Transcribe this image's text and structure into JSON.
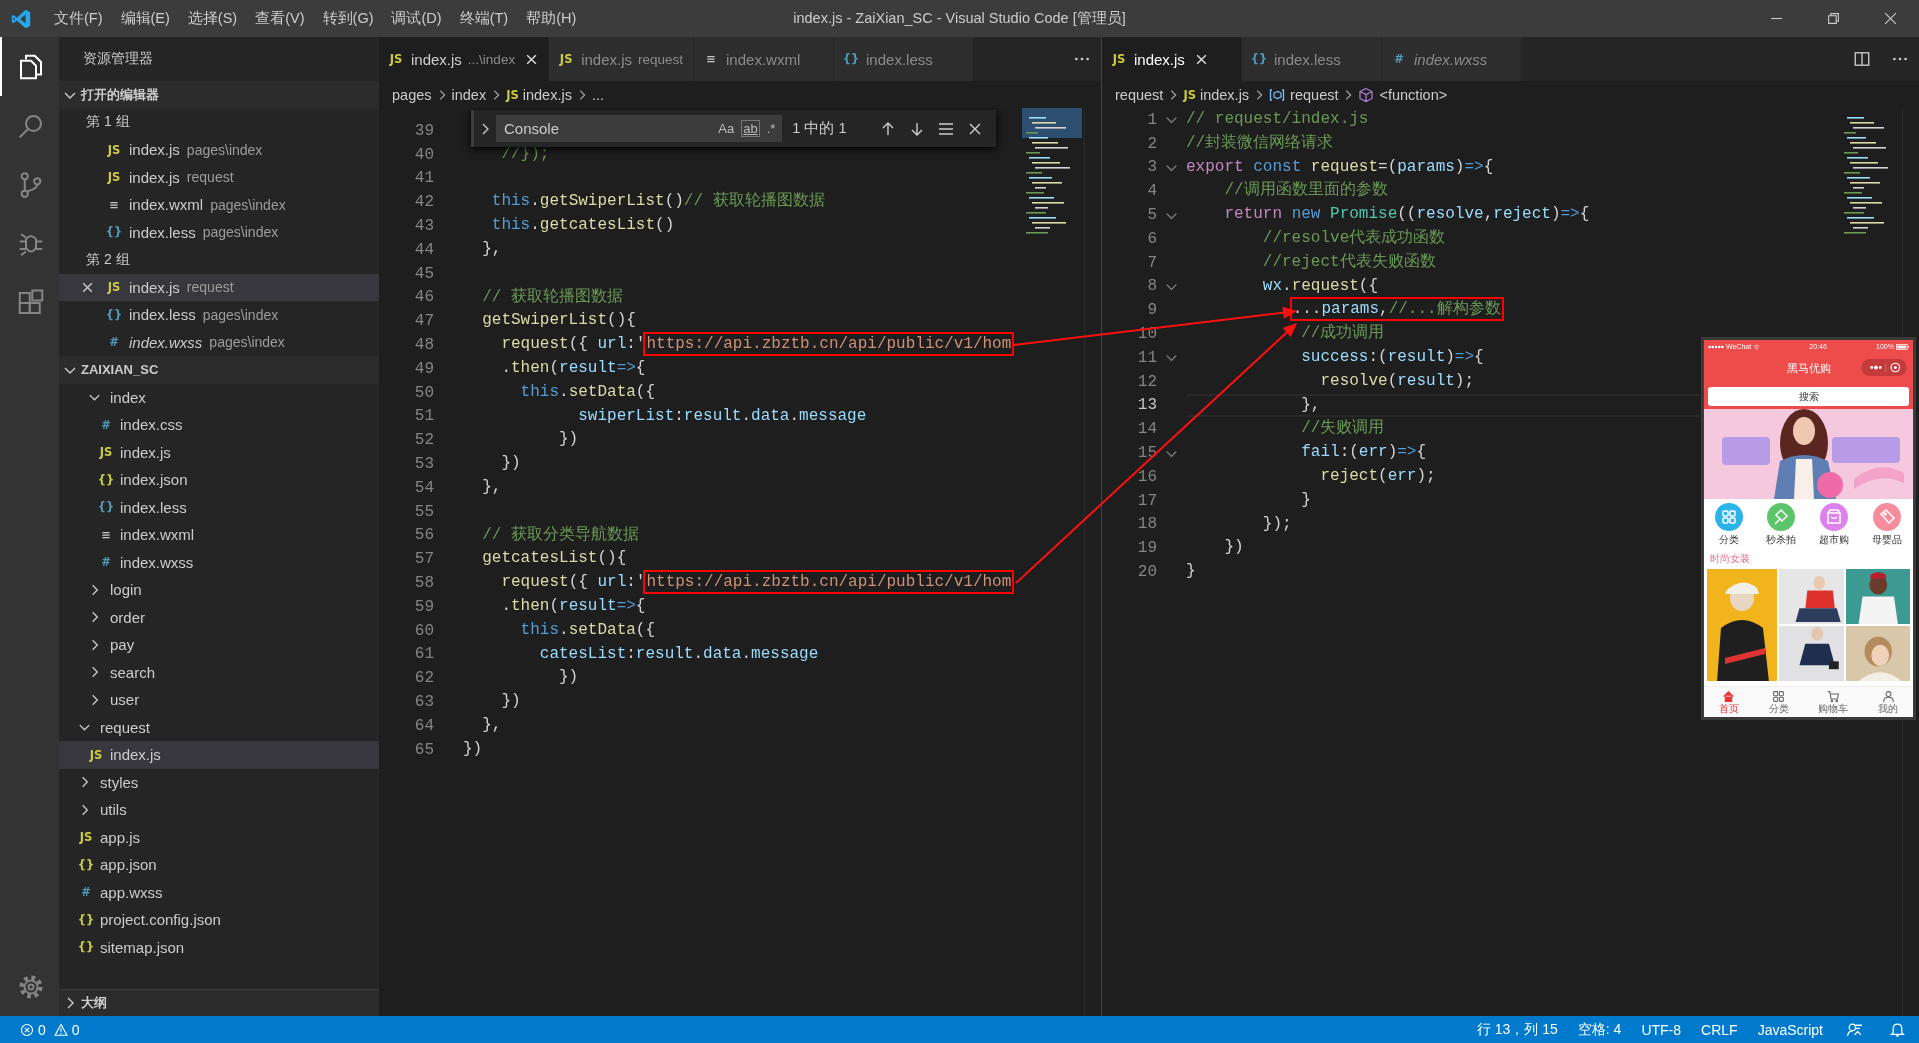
{
  "title_bar": {
    "menus": [
      "文件(F)",
      "编辑(E)",
      "选择(S)",
      "查看(V)",
      "转到(G)",
      "调试(D)",
      "终端(T)",
      "帮助(H)"
    ],
    "title": "index.js - ZaiXian_SC - Visual Studio Code [管理员]"
  },
  "activity_bar": {
    "items": [
      {
        "kind": "explorer",
        "selected": true
      },
      {
        "kind": "search",
        "selected": false
      },
      {
        "kind": "source-control",
        "selected": false
      },
      {
        "kind": "debug",
        "selected": false
      },
      {
        "kind": "extensions",
        "selected": false
      }
    ]
  },
  "sidebar": {
    "title": "资源管理器",
    "open_editors": {
      "title": "打开的编辑器",
      "expanded": true,
      "groups": [
        {
          "title": "第 1 组",
          "items": [
            {
              "icon": "JS",
              "kind": "js",
              "name": "index.js",
              "path": "pages\\index",
              "selected": false,
              "preview": false
            },
            {
              "icon": "JS",
              "kind": "js",
              "name": "index.js",
              "path": "request",
              "selected": false,
              "preview": false
            },
            {
              "icon": "≡",
              "kind": "wxml",
              "name": "index.wxml",
              "path": "pages\\index",
              "selected": false,
              "preview": false
            },
            {
              "icon": "{}",
              "kind": "less",
              "name": "index.less",
              "path": "pages\\index",
              "selected": false,
              "preview": false
            }
          ]
        },
        {
          "title": "第 2 组",
          "items": [
            {
              "icon": "JS",
              "kind": "js",
              "name": "index.js",
              "path": "request",
              "selected": true,
              "preview": false
            },
            {
              "icon": "{}",
              "kind": "less",
              "name": "index.less",
              "path": "pages\\index",
              "selected": false,
              "preview": false
            },
            {
              "icon": "#",
              "kind": "wxss",
              "name": "index.wxss",
              "path": "pages\\index",
              "selected": false,
              "preview": true
            }
          ]
        }
      ]
    },
    "folder": {
      "title": "ZAIXIAN_SC",
      "expanded": true,
      "items": [
        {
          "kind": "continued",
          "children": [
            {
              "kind": "folder",
              "name": "index",
              "expanded": true,
              "selected": false,
              "children": [
                {
                  "icon": "#",
                  "kind": "css",
                  "name": "index.css",
                  "selected": false
                },
                {
                  "icon": "JS",
                  "kind": "js",
                  "name": "index.js",
                  "selected": false
                },
                {
                  "icon": "{}",
                  "kind": "json",
                  "name": "index.json",
                  "selected": false
                },
                {
                  "icon": "{}",
                  "kind": "less",
                  "name": "index.less",
                  "selected": false
                },
                {
                  "icon": "≡",
                  "kind": "wxml",
                  "name": "index.wxml",
                  "selected": false
                },
                {
                  "icon": "#",
                  "kind": "wxss",
                  "name": "index.wxss",
                  "selected": false
                }
              ]
            },
            {
              "kind": "folder",
              "name": "login",
              "expanded": false,
              "selected": false
            },
            {
              "kind": "folder",
              "name": "order",
              "expanded": false,
              "selected": false
            },
            {
              "kind": "folder",
              "name": "pay",
              "expanded": false,
              "selected": false
            },
            {
              "kind": "folder",
              "name": "search",
              "expanded": false,
              "selected": false
            },
            {
              "kind": "folder",
              "name": "user",
              "expanded": false,
              "selected": false
            }
          ]
        },
        {
          "kind": "folder",
          "name": "request",
          "expanded": true,
          "selected": false,
          "children": [
            {
              "icon": "JS",
              "kind": "js",
              "name": "index.js",
              "selected": true
            }
          ]
        },
        {
          "kind": "folder",
          "name": "styles",
          "expanded": false,
          "selected": false
        },
        {
          "kind": "folder",
          "name": "utils",
          "expanded": false,
          "selected": false
        },
        {
          "icon": "JS",
          "kind": "js",
          "name": "app.js",
          "selected": false
        },
        {
          "icon": "{}",
          "kind": "json",
          "name": "app.json",
          "selected": false
        },
        {
          "icon": "#",
          "kind": "wxss",
          "name": "app.wxss",
          "selected": false
        },
        {
          "icon": "{}",
          "kind": "json",
          "name": "project.config.json",
          "selected": false
        },
        {
          "icon": "{}",
          "kind": "json",
          "name": "sitemap.json",
          "selected": false
        }
      ]
    },
    "outline": {
      "title": "大纲",
      "expanded": false
    }
  },
  "editor_groups": [
    {
      "focused": false,
      "tabs": [
        {
          "icon": "JS",
          "kind": "js",
          "name": "index.js",
          "description": "...\\index",
          "selected": true,
          "preview": false
        },
        {
          "icon": "JS",
          "kind": "js",
          "name": "index.js",
          "description": "request",
          "selected": false,
          "preview": false
        },
        {
          "icon": "≡",
          "kind": "wxml",
          "name": "index.wxml",
          "selected": false,
          "preview": false
        },
        {
          "icon": "{}",
          "kind": "less",
          "name": "index.less",
          "selected": false,
          "preview": false
        }
      ],
      "breadcrumbs": [
        {
          "text": "pages"
        },
        {
          "text": "index"
        },
        {
          "text": "index.js",
          "icon": "JS",
          "kind": "js"
        },
        {
          "text": "..."
        }
      ],
      "find_widget": {
        "value": "Console",
        "options": [
          "Aa",
          "ab",
          ".*"
        ],
        "match_count": "1 中的 1"
      },
      "lines": [
        {
          "number": "39"
        },
        {
          "number": "40",
          "tokens": [
            {
              "kind": "comment",
              "text": "    //});"
            }
          ]
        },
        {
          "number": "41"
        },
        {
          "number": "42",
          "tokens": [
            {
              "kind": "keyword",
              "text": "   this"
            },
            {
              "kind": "plain",
              "text": "."
            },
            {
              "kind": "function",
              "text": "getSwiperList"
            },
            {
              "kind": "plain",
              "text": "()"
            },
            {
              "kind": "comment",
              "text": "// 获取轮播图数据"
            }
          ]
        },
        {
          "number": "43",
          "tokens": [
            {
              "kind": "keyword",
              "text": "   this"
            },
            {
              "kind": "plain",
              "text": "."
            },
            {
              "kind": "function",
              "text": "getcatesList"
            },
            {
              "kind": "plain",
              "text": "()"
            }
          ]
        },
        {
          "number": "44",
          "tokens": [
            {
              "kind": "plain",
              "text": "  },"
            }
          ]
        },
        {
          "number": "45"
        },
        {
          "number": "46",
          "tokens": [
            {
              "kind": "comment",
              "text": "  // 获取轮播图数据"
            }
          ]
        },
        {
          "number": "47",
          "tokens": [
            {
              "kind": "function",
              "text": "  getSwiperList"
            },
            {
              "kind": "plain",
              "text": "(){"
            }
          ]
        },
        {
          "number": "48",
          "tokens": [
            {
              "kind": "function",
              "text": "    request"
            },
            {
              "kind": "plain",
              "text": "({ "
            },
            {
              "kind": "variable",
              "text": "url"
            },
            {
              "kind": "plain",
              "text": ":'"
            }
          ],
          "boxed_tokens": [
            {
              "kind": "string",
              "text": "https://api.zbztb.cn/api/public/v1/hom"
            }
          ]
        },
        {
          "number": "49",
          "tokens": [
            {
              "kind": "plain",
              "text": "    ."
            },
            {
              "kind": "function",
              "text": "then"
            },
            {
              "kind": "plain",
              "text": "("
            },
            {
              "kind": "variable",
              "text": "result"
            },
            {
              "kind": "keyword",
              "text": "=>"
            },
            {
              "kind": "plain",
              "text": "{"
            }
          ]
        },
        {
          "number": "50",
          "tokens": [
            {
              "kind": "keyword",
              "text": "      this"
            },
            {
              "kind": "plain",
              "text": "."
            },
            {
              "kind": "function",
              "text": "setData"
            },
            {
              "kind": "plain",
              "text": "({"
            }
          ]
        },
        {
          "number": "51",
          "tokens": [
            {
              "kind": "variable",
              "text": "            swiperList"
            },
            {
              "kind": "plain",
              "text": ":"
            },
            {
              "kind": "variable",
              "text": "result"
            },
            {
              "kind": "plain",
              "text": "."
            },
            {
              "kind": "variable",
              "text": "data"
            },
            {
              "kind": "plain",
              "text": "."
            },
            {
              "kind": "variable",
              "text": "message"
            }
          ]
        },
        {
          "number": "52",
          "tokens": [
            {
              "kind": "plain",
              "text": "          })"
            }
          ]
        },
        {
          "number": "53",
          "tokens": [
            {
              "kind": "plain",
              "text": "    })"
            }
          ]
        },
        {
          "number": "54",
          "tokens": [
            {
              "kind": "plain",
              "text": "  },"
            }
          ]
        },
        {
          "number": "55"
        },
        {
          "number": "56",
          "tokens": [
            {
              "kind": "comment",
              "text": "  // 获取分类导航数据"
            }
          ]
        },
        {
          "number": "57",
          "tokens": [
            {
              "kind": "function",
              "text": "  getcatesList"
            },
            {
              "kind": "plain",
              "text": "(){"
            }
          ]
        },
        {
          "number": "58",
          "tokens": [
            {
              "kind": "function",
              "text": "    request"
            },
            {
              "kind": "plain",
              "text": "({ "
            },
            {
              "kind": "variable",
              "text": "url"
            },
            {
              "kind": "plain",
              "text": ":'"
            }
          ],
          "boxed_tokens": [
            {
              "kind": "string",
              "text": "https://api.zbztb.cn/api/public/v1/hom"
            }
          ]
        },
        {
          "number": "59",
          "tokens": [
            {
              "kind": "plain",
              "text": "    ."
            },
            {
              "kind": "function",
              "text": "then"
            },
            {
              "kind": "plain",
              "text": "("
            },
            {
              "kind": "variable",
              "text": "result"
            },
            {
              "kind": "keyword",
              "text": "=>"
            },
            {
              "kind": "plain",
              "text": "{"
            }
          ]
        },
        {
          "number": "60",
          "tokens": [
            {
              "kind": "keyword",
              "text": "      this"
            },
            {
              "kind": "plain",
              "text": "."
            },
            {
              "kind": "function",
              "text": "setData"
            },
            {
              "kind": "plain",
              "text": "({"
            }
          ]
        },
        {
          "number": "61",
          "tokens": [
            {
              "kind": "variable",
              "text": "        catesList"
            },
            {
              "kind": "plain",
              "text": ":"
            },
            {
              "kind": "variable",
              "text": "result"
            },
            {
              "kind": "plain",
              "text": "."
            },
            {
              "kind": "variable",
              "text": "data"
            },
            {
              "kind": "plain",
              "text": "."
            },
            {
              "kind": "variable",
              "text": "message"
            }
          ]
        },
        {
          "number": "62",
          "tokens": [
            {
              "kind": "plain",
              "text": "          })"
            }
          ]
        },
        {
          "number": "63",
          "tokens": [
            {
              "kind": "plain",
              "text": "    })"
            }
          ]
        },
        {
          "number": "64",
          "tokens": [
            {
              "kind": "plain",
              "text": "  },"
            }
          ]
        },
        {
          "number": "65",
          "tokens": [
            {
              "kind": "plain",
              "text": "})"
            }
          ]
        }
      ]
    },
    {
      "focused": true,
      "tabs": [
        {
          "icon": "JS",
          "kind": "js",
          "name": "index.js",
          "selected": true,
          "preview": false
        },
        {
          "icon": "{}",
          "kind": "less",
          "name": "index.less",
          "selected": false,
          "preview": false
        },
        {
          "icon": "#",
          "kind": "wxss",
          "name": "index.wxss",
          "selected": false,
          "preview": true
        }
      ],
      "breadcrumbs": [
        {
          "text": "request"
        },
        {
          "text": "index.js",
          "icon": "JS",
          "kind": "js"
        },
        {
          "text": "request",
          "kind": "variable"
        },
        {
          "text": "<function>",
          "kind": "function"
        }
      ],
      "lines": [
        {
          "number": "1",
          "foldable": true,
          "current": false,
          "tokens": [
            {
              "kind": "comment",
              "text": "// request/index.js"
            }
          ]
        },
        {
          "number": "2",
          "foldable": false,
          "current": false,
          "tokens": [
            {
              "kind": "comment",
              "text": "//封装微信网络请求"
            }
          ]
        },
        {
          "number": "3",
          "foldable": true,
          "current": false,
          "tokens": [
            {
              "kind": "control",
              "text": "export "
            },
            {
              "kind": "keyword",
              "text": "const "
            },
            {
              "kind": "function",
              "text": "request"
            },
            {
              "kind": "plain",
              "text": "=("
            },
            {
              "kind": "variable",
              "text": "params"
            },
            {
              "kind": "plain",
              "text": ")"
            },
            {
              "kind": "keyword",
              "text": "=>"
            },
            {
              "kind": "plain",
              "text": "{"
            }
          ]
        },
        {
          "number": "4",
          "foldable": false,
          "current": false,
          "tokens": [
            {
              "kind": "comment",
              "text": "    //调用函数里面的参数"
            }
          ]
        },
        {
          "number": "5",
          "foldable": true,
          "current": false,
          "tokens": [
            {
              "kind": "control",
              "text": "    return "
            },
            {
              "kind": "keyword",
              "text": "new "
            },
            {
              "kind": "type",
              "text": "Promise"
            },
            {
              "kind": "plain",
              "text": "(("
            },
            {
              "kind": "variable",
              "text": "resolve"
            },
            {
              "kind": "plain",
              "text": ","
            },
            {
              "kind": "variable",
              "text": "reject"
            },
            {
              "kind": "plain",
              "text": ")"
            },
            {
              "kind": "keyword",
              "text": "=>"
            },
            {
              "kind": "plain",
              "text": "{"
            }
          ]
        },
        {
          "number": "6",
          "foldable": false,
          "current": false,
          "tokens": [
            {
              "kind": "comment",
              "text": "        //resolve代表成功函数"
            }
          ]
        },
        {
          "number": "7",
          "foldable": false,
          "current": false,
          "tokens": [
            {
              "kind": "comment",
              "text": "        //reject代表失败函数"
            }
          ]
        },
        {
          "number": "8",
          "foldable": true,
          "current": false,
          "tokens": [
            {
              "kind": "variable",
              "text": "        wx"
            },
            {
              "kind": "plain",
              "text": "."
            },
            {
              "kind": "function",
              "text": "request"
            },
            {
              "kind": "plain",
              "text": "({"
            }
          ]
        },
        {
          "number": "9",
          "foldable": false,
          "current": false,
          "boxed_tokens": [
            {
              "kind": "plain",
              "text": "           ..."
            },
            {
              "kind": "variable",
              "text": "params"
            },
            {
              "kind": "plain",
              "text": ","
            },
            {
              "kind": "comment",
              "text": "//...解构参数"
            }
          ]
        },
        {
          "number": "10",
          "foldable": false,
          "current": false,
          "tokens": [
            {
              "kind": "comment",
              "text": "            //成功调用"
            }
          ]
        },
        {
          "number": "11",
          "foldable": true,
          "current": false,
          "tokens": [
            {
              "kind": "variable",
              "text": "            success"
            },
            {
              "kind": "plain",
              "text": ":("
            },
            {
              "kind": "variable",
              "text": "result"
            },
            {
              "kind": "plain",
              "text": ")"
            },
            {
              "kind": "keyword",
              "text": "=>"
            },
            {
              "kind": "plain",
              "text": "{"
            }
          ]
        },
        {
          "number": "12",
          "foldable": false,
          "current": false,
          "tokens": [
            {
              "kind": "function",
              "text": "              resolve"
            },
            {
              "kind": "plain",
              "text": "("
            },
            {
              "kind": "variable",
              "text": "result"
            },
            {
              "kind": "plain",
              "text": ");"
            }
          ]
        },
        {
          "number": "13",
          "foldable": false,
          "current": true,
          "tokens": [
            {
              "kind": "plain",
              "text": "            },"
            }
          ]
        },
        {
          "number": "14",
          "foldable": false,
          "current": false,
          "tokens": [
            {
              "kind": "comment",
              "text": "            //失败调用"
            }
          ]
        },
        {
          "number": "15",
          "foldable": true,
          "current": false,
          "tokens": [
            {
              "kind": "variable",
              "text": "            fail"
            },
            {
              "kind": "plain",
              "text": ":("
            },
            {
              "kind": "variable",
              "text": "err"
            },
            {
              "kind": "plain",
              "text": ")"
            },
            {
              "kind": "keyword",
              "text": "=>"
            },
            {
              "kind": "plain",
              "text": "{"
            }
          ]
        },
        {
          "number": "16",
          "foldable": false,
          "current": false,
          "tokens": [
            {
              "kind": "function",
              "text": "              reject"
            },
            {
              "kind": "plain",
              "text": "("
            },
            {
              "kind": "variable",
              "text": "err"
            },
            {
              "kind": "plain",
              "text": ");"
            }
          ]
        },
        {
          "number": "17",
          "foldable": false,
          "current": false,
          "tokens": [
            {
              "kind": "plain",
              "text": "            }"
            }
          ]
        },
        {
          "number": "18",
          "foldable": false,
          "current": false,
          "tokens": [
            {
              "kind": "plain",
              "text": "        });"
            }
          ]
        },
        {
          "number": "19",
          "foldable": false,
          "current": false,
          "tokens": [
            {
              "kind": "plain",
              "text": "    })"
            }
          ]
        },
        {
          "number": "20",
          "foldable": false,
          "current": false,
          "tokens": [
            {
              "kind": "plain",
              "text": "}"
            }
          ]
        }
      ]
    }
  ],
  "phone_preview": {
    "status": {
      "carrier": "WeChat",
      "time": "20:46",
      "battery": "100%"
    },
    "title": "黑马优购",
    "search": {
      "placeholder": "搜索"
    },
    "categories": [
      {
        "label": "分类",
        "kind": "grid",
        "color": "#2bb3ea"
      },
      {
        "label": "秒杀拍",
        "kind": "hammer",
        "color": "#5cc46b"
      },
      {
        "label": "超市购",
        "kind": "shop",
        "color": "#dd82ec"
      },
      {
        "label": "母婴品",
        "kind": "tag",
        "color": "#f78c9c"
      }
    ],
    "section_title": "时尚女装",
    "tabs": [
      {
        "label": "首页",
        "kind": "home",
        "selected": true
      },
      {
        "label": "分类",
        "kind": "grid",
        "selected": false
      },
      {
        "label": "购物车",
        "kind": "cart",
        "selected": false
      },
      {
        "label": "我的",
        "kind": "person",
        "selected": false
      }
    ]
  },
  "status_bar": {
    "problems": [
      {
        "kind": "error",
        "count": "0"
      },
      {
        "kind": "warning",
        "count": "0"
      }
    ],
    "items": [
      "行 13，列 15",
      "空格: 4",
      "UTF-8",
      "CRLF",
      "JavaScript"
    ]
  }
}
